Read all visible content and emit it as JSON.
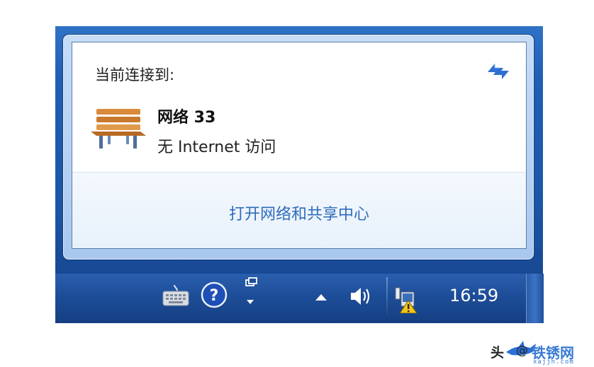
{
  "popup": {
    "connected_label": "当前连接到:",
    "network_name": "网络  33",
    "network_status": "无 Internet 访问",
    "network_icon": "bench-network-icon",
    "refresh_icon": "refresh-arrows-icon",
    "open_center_link": "打开网络和共享中心"
  },
  "taskbar": {
    "tray_icons": [
      "keyboard-icon",
      "help-icon",
      "windows-icon",
      "show-hidden-icons-arrow",
      "volume-icon",
      "network-warning-icon"
    ],
    "clock": "16:59"
  },
  "watermark": {
    "prefix": "头",
    "handle": "@",
    "brand": "铁锈网",
    "site": "xajjn.com"
  },
  "colors": {
    "link": "#2f6cbc",
    "taskbar": "#1d4d98",
    "frame": "#1f5fb4"
  }
}
